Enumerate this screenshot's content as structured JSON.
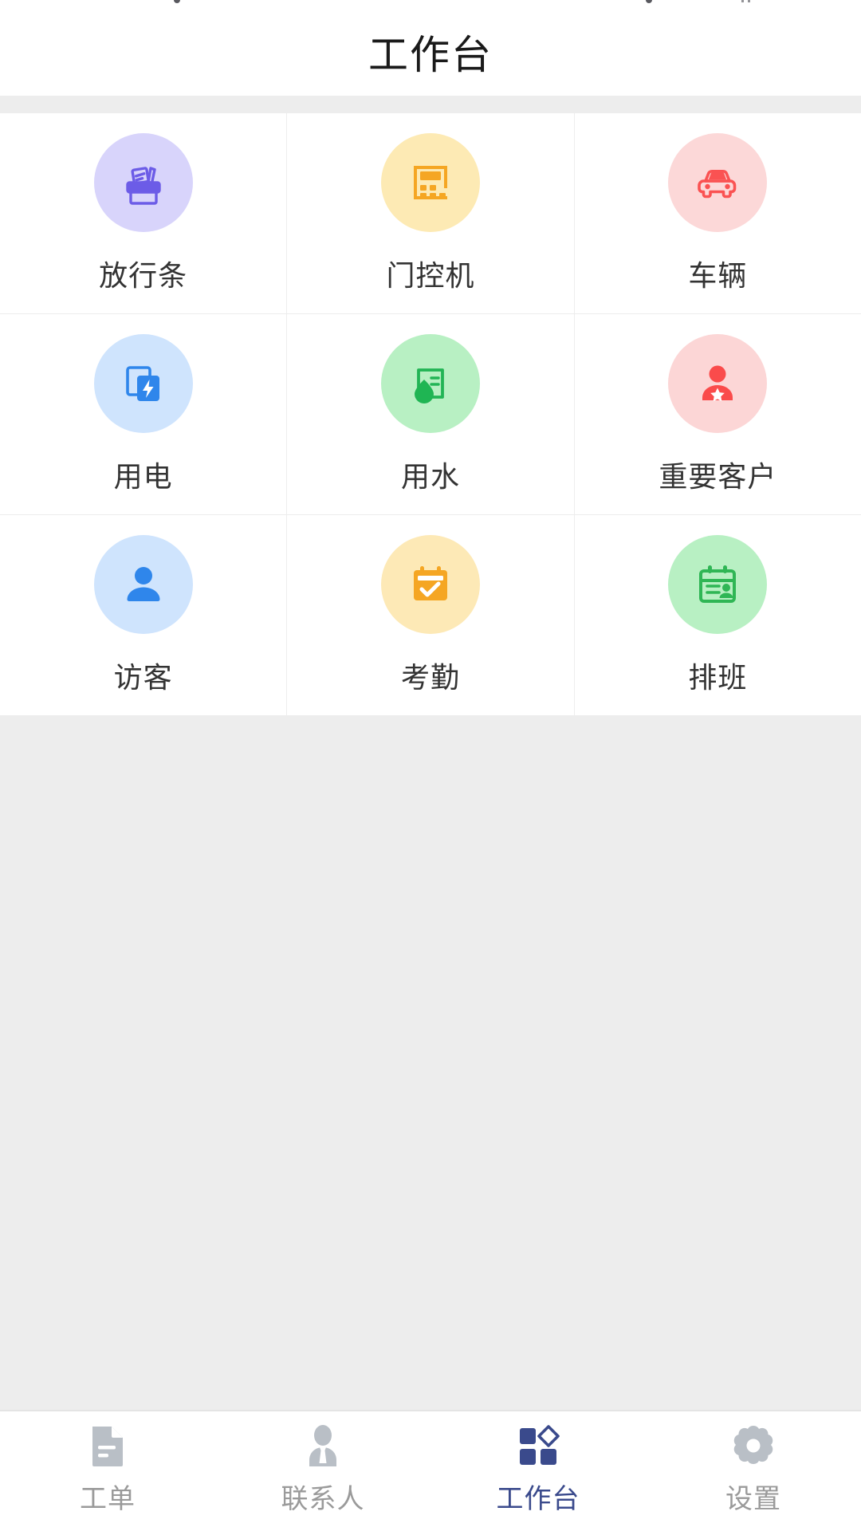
{
  "app": {
    "title": "工作台",
    "background_color": "#ededed",
    "surface_color": "#ffffff",
    "divider_color": "#ededed"
  },
  "header": {
    "title": "工作台",
    "title_color": "#1a1a1a"
  },
  "grid": {
    "columns": 3,
    "tiles": [
      {
        "label": "放行条",
        "icon": "pass-slip-icon",
        "bubble_color": "#d8d4fb",
        "icon_color": "#6c5ce7"
      },
      {
        "label": "门控机",
        "icon": "door-access-keypad-icon",
        "bubble_color": "#fdeab4",
        "icon_color": "#f5a623"
      },
      {
        "label": "车辆",
        "icon": "car-icon",
        "bubble_color": "#fcd8d8",
        "icon_color": "#fa5252"
      },
      {
        "label": "用电",
        "icon": "electricity-icon",
        "bubble_color": "#cfe4fd",
        "icon_color": "#2f86eb"
      },
      {
        "label": "用水",
        "icon": "water-icon",
        "bubble_color": "#b8f0c3",
        "icon_color": "#22b455"
      },
      {
        "label": "重要客户",
        "icon": "vip-customer-icon",
        "bubble_color": "#fcd6d6",
        "icon_color": "#fa4b4b"
      },
      {
        "label": "访客",
        "icon": "visitor-icon",
        "bubble_color": "#cfe4fd",
        "icon_color": "#2f86eb"
      },
      {
        "label": "考勤",
        "icon": "attendance-calendar-icon",
        "bubble_color": "#fde9b6",
        "icon_color": "#f5a623"
      },
      {
        "label": "排班",
        "icon": "shift-schedule-icon",
        "bubble_color": "#b8f0c3",
        "icon_color": "#2fb655"
      }
    ]
  },
  "tabbar": {
    "active_color": "#3a4a8c",
    "inactive_color": "#b9bfc6",
    "active_index": 2,
    "tabs": [
      {
        "label": "工单",
        "icon": "document-icon"
      },
      {
        "label": "联系人",
        "icon": "contacts-person-icon"
      },
      {
        "label": "工作台",
        "icon": "workbench-grid-icon"
      },
      {
        "label": "设置",
        "icon": "gear-icon"
      }
    ]
  }
}
